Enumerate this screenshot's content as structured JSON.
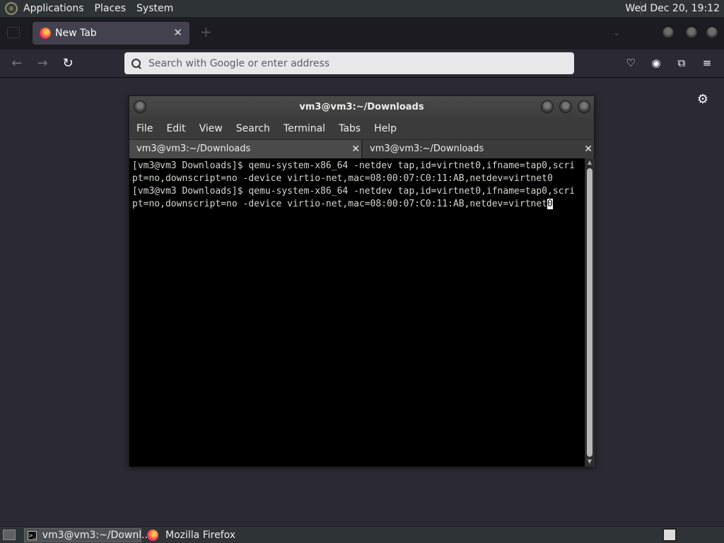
{
  "top_panel": {
    "menus": [
      "Applications",
      "Places",
      "System"
    ],
    "clock": "Wed Dec 20, 19:12"
  },
  "firefox": {
    "tab_title": "New Tab",
    "url_placeholder": "Search with Google or enter address",
    "window_title": "Mozilla Firefox"
  },
  "terminal": {
    "title": "vm3@vm3:~/Downloads",
    "menu": [
      "File",
      "Edit",
      "View",
      "Search",
      "Terminal",
      "Tabs",
      "Help"
    ],
    "tabs": [
      "vm3@vm3:~/Downloads",
      "vm3@vm3:~/Downloads"
    ],
    "lines": [
      "[vm3@vm3 Downloads]$ qemu-system-x86_64 -netdev tap,id=virtnet0,ifname=tap0,scri",
      "pt=no,downscript=no -device virtio-net,mac=08:00:07:C0:11:AB,netdev=virtnet0",
      "[vm3@vm3 Downloads]$ qemu-system-x86_64 -netdev tap,id=virtnet0,ifname=tap0,scri",
      "pt=no,downscript=no -device virtio-net,mac=08:00:07:C0:11:AB,netdev=virtnet"
    ],
    "cursor_char": "0"
  },
  "taskbar": {
    "items": [
      "vm3@vm3:~/Downl...",
      "Mozilla Firefox"
    ]
  }
}
